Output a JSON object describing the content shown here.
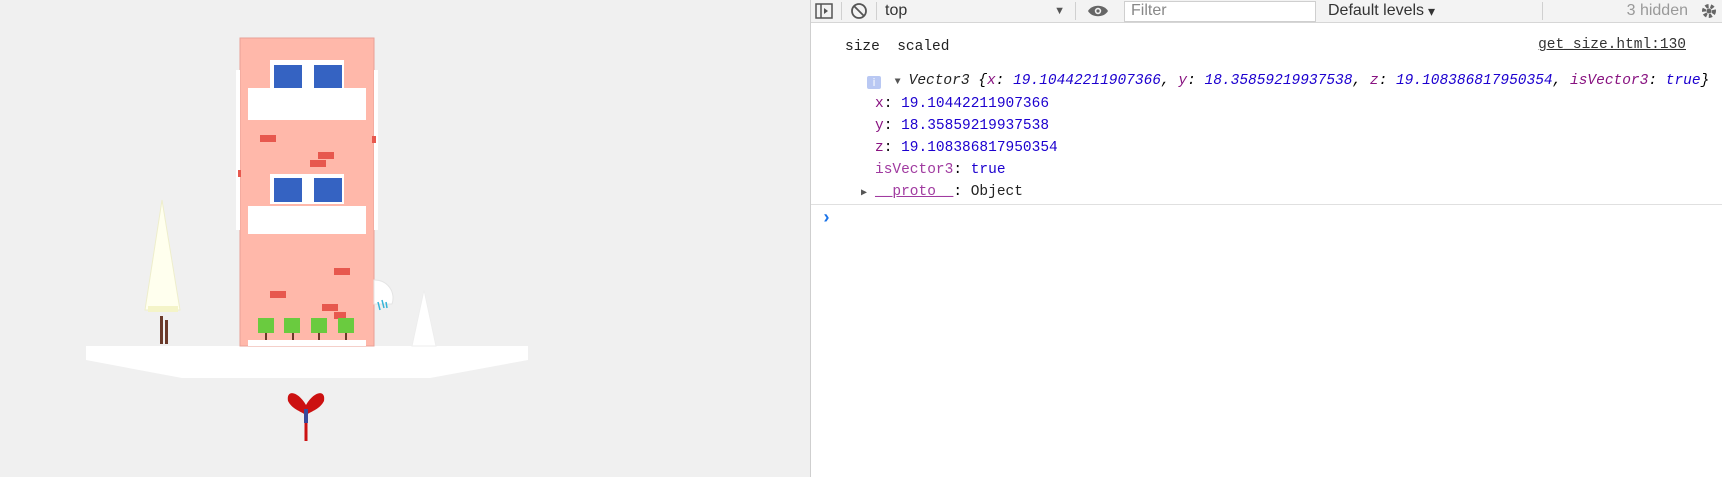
{
  "scene": {
    "colors": {
      "background": "#f0f0f0",
      "building": "#ffb8aa",
      "window": "#3563c2",
      "balcony": "#ffffff",
      "brick": "#e7584e",
      "plant": "#6acb3f",
      "tree": "#ffffee",
      "trunk": "#6b3a2a",
      "bird": "#cc1111"
    }
  },
  "toolbar": {
    "sidebar_icon": "sidebar-toggle-icon",
    "clear_icon": "block-icon",
    "context_value": "top",
    "context_arrow": "▼",
    "eye_icon": "eye-icon",
    "filter_placeholder": "Filter",
    "levels_label": "Default levels",
    "levels_arrow": "▾",
    "hidden_count": "3 hidden",
    "settings_icon": "gear-icon"
  },
  "console": {
    "log_line": "size  scaled",
    "source_link": "get_size.html:130",
    "vector": {
      "class_name": "Vector3",
      "preview_open": "{",
      "preview_x_key": "x",
      "preview_x_val": "19.10442211907366",
      "preview_y_key": "y",
      "preview_y_val": "18.35859219937538",
      "preview_z_key": "z",
      "preview_z_val": "19.108386817950354",
      "preview_isv_key": "isVector3",
      "preview_isv_val": "true",
      "preview_close": "}",
      "info_badge": "i",
      "props": [
        {
          "key": "x",
          "value": "19.10442211907366"
        },
        {
          "key": "y",
          "value": "18.35859219937538"
        },
        {
          "key": "z",
          "value": "19.108386817950354"
        },
        {
          "key": "isVector3",
          "value": "true"
        }
      ],
      "proto_key": "__proto__",
      "proto_value": "Object"
    },
    "prompt_symbol": "›"
  }
}
